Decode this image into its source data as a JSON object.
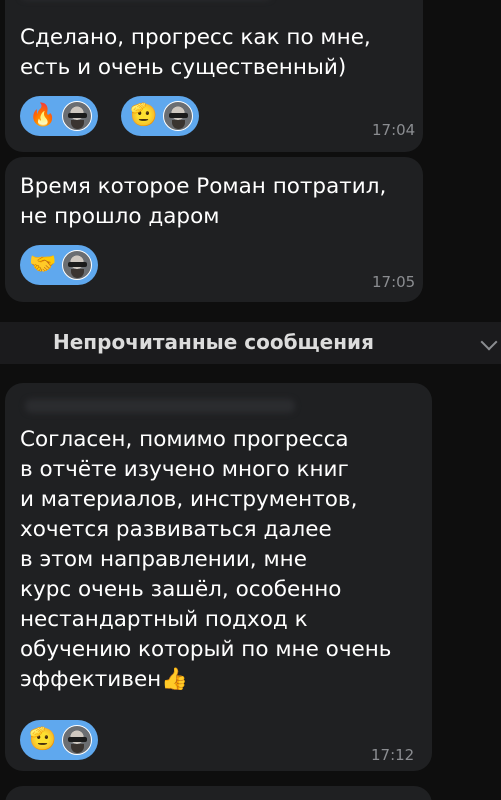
{
  "messages": [
    {
      "text": "Сделано,  прогресс как по мне,\nесть и очень существенный)",
      "time": "17:04",
      "reactions": [
        {
          "emoji": "🔥",
          "icon": "fire-icon"
        },
        {
          "emoji": "🫡",
          "icon": "salute-icon"
        }
      ]
    },
    {
      "text": "Время которое Роман потратил,\nне прошло даром",
      "time": "17:05",
      "reactions": [
        {
          "emoji": "🤝",
          "icon": "handshake-icon"
        }
      ]
    },
    {
      "text": "Согласен, помимо прогресса\nв отчёте изучено много книг\nи материалов, инструментов,\nхочется развиваться далее\nв этом направлении, мне\nкурс очень зашёл, особенно\nнестандартный подход к\nобучению который по мне очень\nэффективен👍",
      "time": "17:12",
      "reactions": [
        {
          "emoji": "🫡",
          "icon": "salute-icon"
        }
      ]
    }
  ],
  "unread_divider": "Непрочитанные сообщения",
  "colors": {
    "background": "#0e0e0e",
    "bubble": "#1f2022",
    "reaction": "#5fa8ee",
    "time": "#8b8d91"
  }
}
